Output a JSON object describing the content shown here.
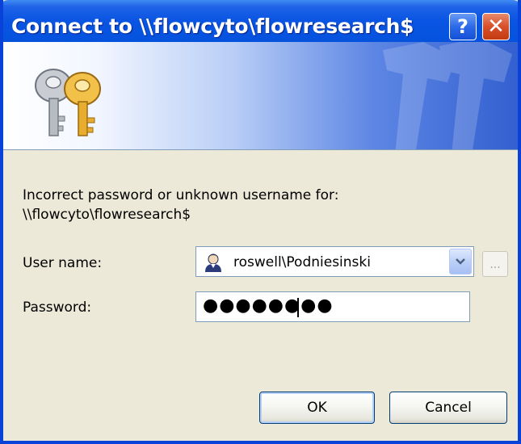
{
  "window": {
    "title": "Connect to \\\\flowcyto\\flowresearch$",
    "help_glyph": "?",
    "close_glyph": "✕"
  },
  "banner": {
    "icon": "keys-icon"
  },
  "message": {
    "line1": "Incorrect password or unknown username for:",
    "line2": "\\\\flowcyto\\flowresearch$"
  },
  "form": {
    "username_label": "User name:",
    "username_value": "roswell\\Podniesinski",
    "browse_label": "...",
    "password_label": "Password:",
    "password_masked": "●●●●●●●●"
  },
  "buttons": {
    "ok": "OK",
    "cancel": "Cancel"
  },
  "colors": {
    "titlebar": "#0553de",
    "window_bg": "#ece9d8",
    "close_button": "#d7502a"
  }
}
